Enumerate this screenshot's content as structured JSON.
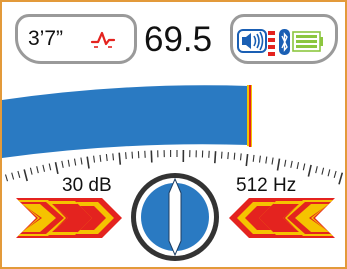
{
  "depth": {
    "value": "3’7”"
  },
  "signal": {
    "value": "69.5"
  },
  "gain": {
    "label": "30 dB"
  },
  "frequency": {
    "label": "512 Hz"
  },
  "signal_meter": {
    "level_fraction": 0.72
  },
  "icons": {
    "depth_mode": "peak-signal-icon",
    "speaker": "speaker-icon",
    "signal_bars": "signal-strength-icon",
    "bluetooth": "bluetooth-icon",
    "battery": "battery-icon",
    "left_arrows": "left-guidance-arrows",
    "right_arrows": "right-guidance-arrows",
    "compass": "locate-compass-icon"
  },
  "colors": {
    "accent_blue": "#2a7ac2",
    "arrow_red": "#e4231f",
    "arrow_yellow": "#f5c300",
    "border_orange": "#e39a3a",
    "bluetooth_blue": "#1a5fb4",
    "battery_green": "#8cc63f"
  }
}
